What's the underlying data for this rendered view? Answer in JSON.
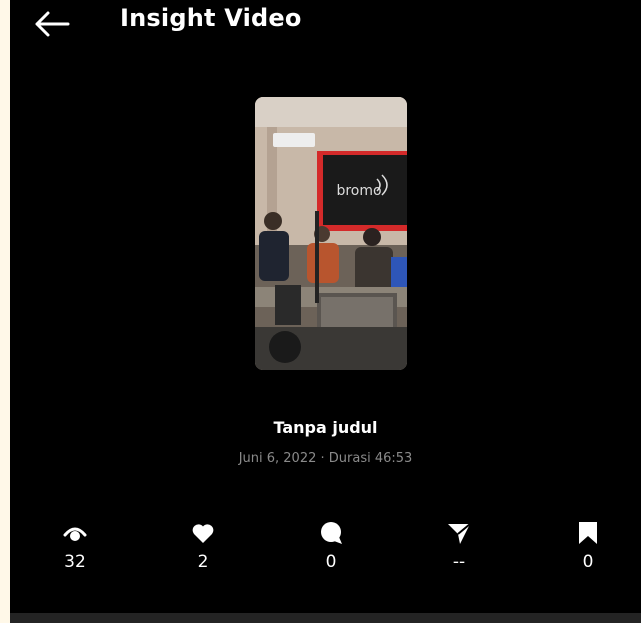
{
  "header": {
    "title": "Insight Video",
    "back_icon": "arrow-left-icon"
  },
  "video": {
    "title": "Tanpa judul",
    "meta": "Juni 6, 2022 · Durasi 46:53",
    "thumbnail_logo_text": "bromo"
  },
  "stats": [
    {
      "name": "views",
      "icon": "eye-icon",
      "value": "32"
    },
    {
      "name": "likes",
      "icon": "heart-icon",
      "value": "2"
    },
    {
      "name": "comments",
      "icon": "comment-icon",
      "value": "0"
    },
    {
      "name": "shares",
      "icon": "send-icon",
      "value": "--"
    },
    {
      "name": "saves",
      "icon": "bookmark-icon",
      "value": "0"
    }
  ],
  "colors": {
    "background": "#000000",
    "text": "#ffffff",
    "meta_text": "#8a8a8a"
  }
}
